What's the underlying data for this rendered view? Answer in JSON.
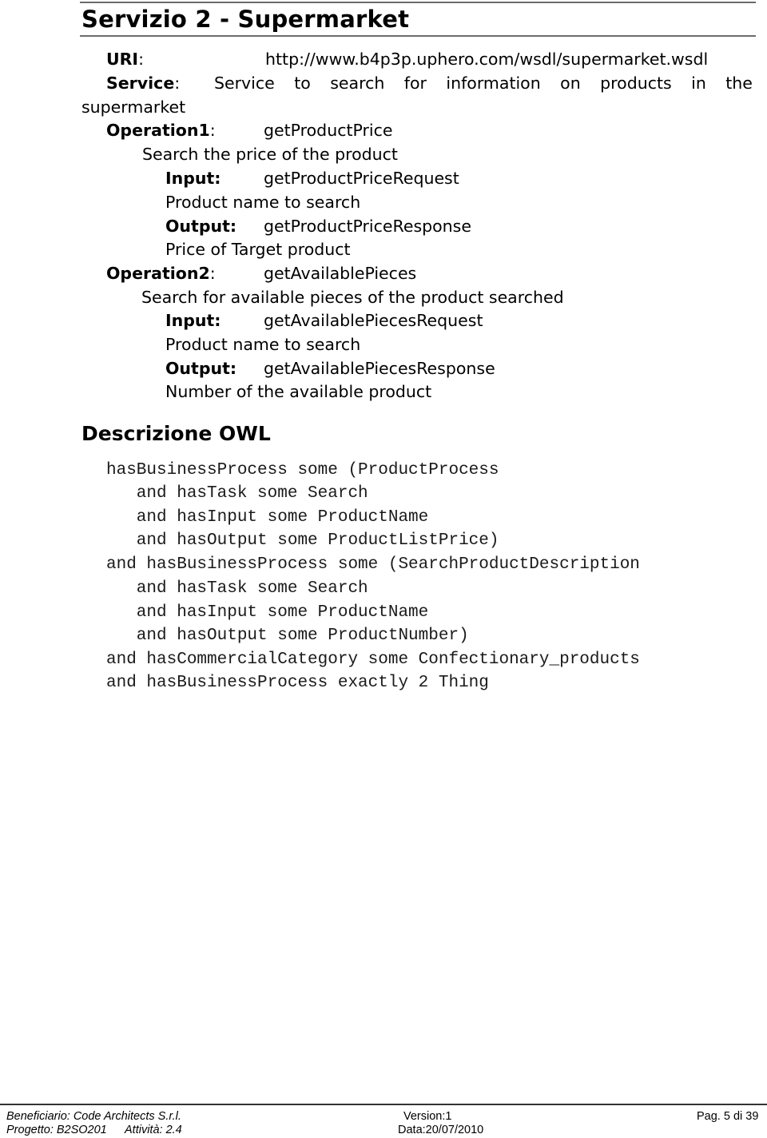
{
  "document": {
    "title": "Servizio 2 - Supermarket",
    "uri": {
      "label": "URI",
      "value": "http://www.b4p3p.uphero.com/wsdl/supermarket.wsdl"
    },
    "service": {
      "label": "Service",
      "words": [
        "Service",
        "to",
        "search",
        "for",
        "information",
        "on",
        "products",
        "in",
        "the"
      ],
      "continuation": "supermarket"
    },
    "operations": [
      {
        "label": "Operation1",
        "name": "getProductPrice",
        "description": "Search the price of the product",
        "input_label": "Input:",
        "input": "getProductPriceRequest",
        "input_description": "Product name to search",
        "output_label": "Output:",
        "output": "getProductPriceResponse",
        "output_description": "Price of Target product"
      },
      {
        "label": "Operation2",
        "name": "getAvailablePieces",
        "description": "Search for available pieces of the product searched",
        "input_label": "Input:",
        "input": "getAvailablePiecesRequest",
        "input_description": "Product name to search",
        "output_label": "Output:",
        "output": "getAvailablePiecesResponse",
        "output_description": "Number of the available product"
      }
    ],
    "owl_heading": "Descrizione OWL",
    "owl_lines": [
      "hasBusinessProcess some (ProductProcess",
      "   and hasTask some Search",
      "   and hasInput some ProductName",
      "   and hasOutput some ProductListPrice)",
      "and hasBusinessProcess some (SearchProductDescription",
      "   and hasTask some Search",
      "   and hasInput some ProductName",
      "   and hasOutput some ProductNumber)",
      "and hasCommercialCategory some Confectionary_products",
      "and hasBusinessProcess exactly 2 Thing"
    ]
  },
  "footer": {
    "beneficiario": "Beneficiario: Code Architects S.r.l.",
    "progetto": "Progetto: B2SO201",
    "attivita": "Attività: 2.4",
    "version": "Version:1",
    "data": "Data:20/07/2010",
    "page": "Pag. 5 di 39"
  }
}
